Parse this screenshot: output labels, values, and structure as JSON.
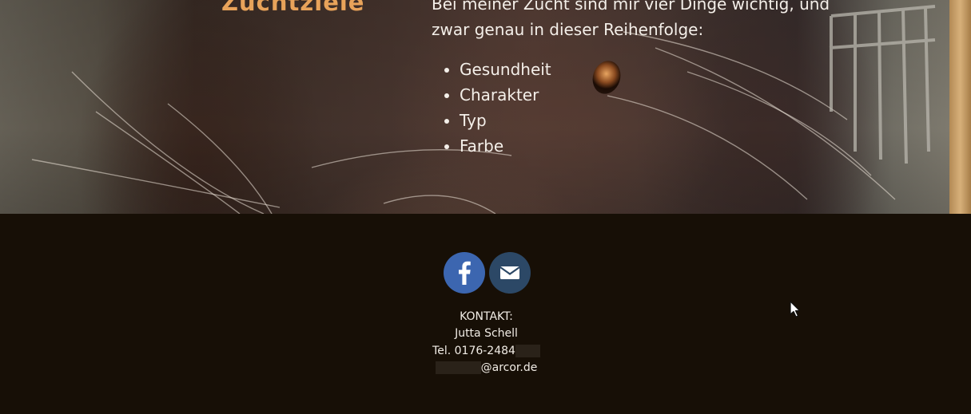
{
  "hero": {
    "section_title": "Zuchtziele",
    "intro_text": "Bei meiner Zucht sind mir vier Dinge wichtig, und zwar genau in dieser Reihenfolge:",
    "goals": [
      "Gesundheit",
      "Charakter",
      "Typ",
      "Farbe"
    ]
  },
  "footer": {
    "social": [
      {
        "name": "facebook",
        "icon": "facebook-icon",
        "color": "#3c66b0"
      },
      {
        "name": "email",
        "icon": "mail-icon",
        "color": "#2c4866"
      }
    ],
    "contact": {
      "heading": "KONTAKT:",
      "name": "Jutta Schell",
      "phone": "Tel. 0176-2484",
      "email_suffix": "@arcor.de"
    }
  },
  "colors": {
    "accent": "#e8a35a",
    "footer_bg": "#170f06",
    "text": "#f4efe9"
  }
}
